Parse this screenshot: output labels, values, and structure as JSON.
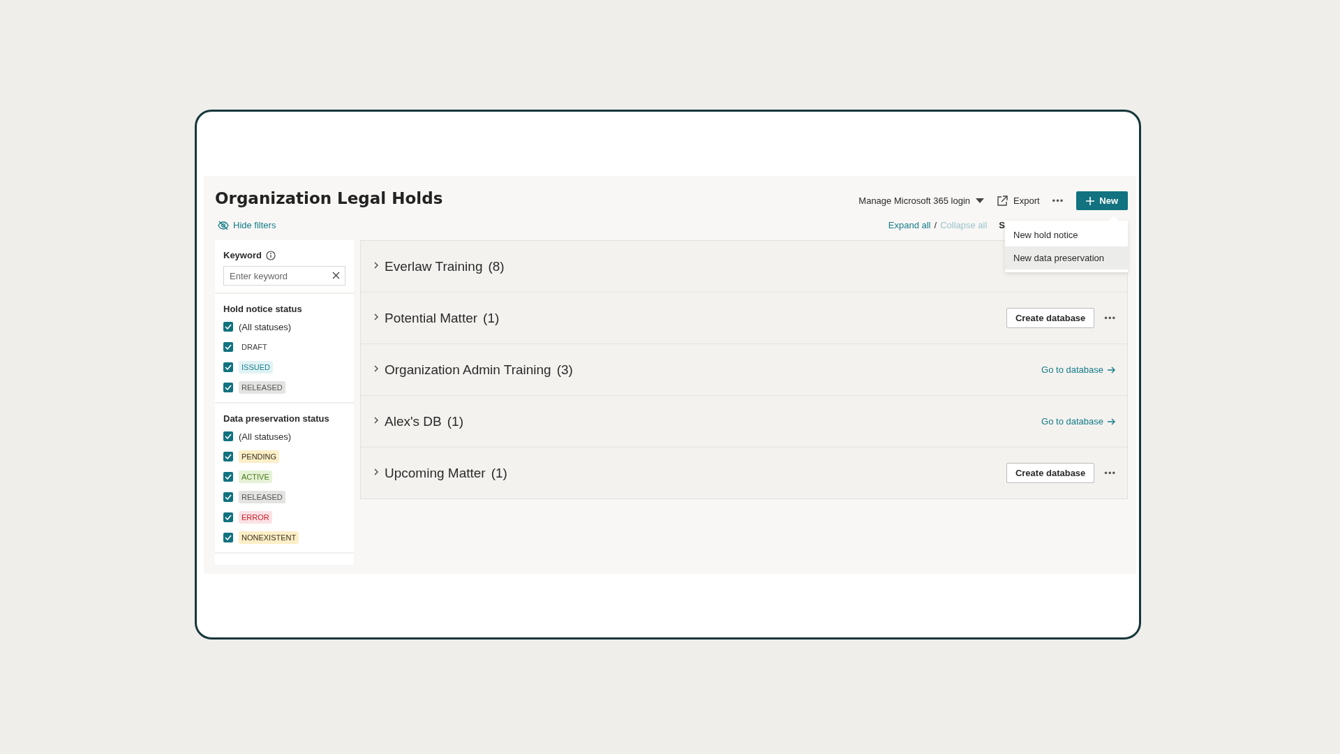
{
  "page": {
    "title": "Organization Legal Holds"
  },
  "toolbar": {
    "login_menu": "Manage Microsoft 365 login",
    "export": "Export",
    "more": "•••",
    "new_button": "New"
  },
  "new_menu": {
    "items": [
      {
        "label": "New hold notice",
        "selected": false
      },
      {
        "label": "New data preservation",
        "selected": true
      }
    ]
  },
  "hide_filters": "Hide filters",
  "expand_collapse": {
    "expand": {
      "label": "Expand all",
      "disabled": false
    },
    "separator": "/",
    "collapse": {
      "label": "Collapse all",
      "disabled": true
    },
    "cut_label": "S"
  },
  "filters": {
    "keyword": {
      "label": "Keyword",
      "placeholder": "Enter keyword"
    },
    "groups": [
      {
        "title": "Hold notice status",
        "options": [
          {
            "label": "(All statuses)",
            "kind": "all",
            "checked": true
          },
          {
            "label": "DRAFT",
            "kind": "plain",
            "checked": true
          },
          {
            "label": "ISSUED",
            "kind": "info",
            "checked": true
          },
          {
            "label": "RELEASED",
            "kind": "neutral",
            "checked": true
          }
        ]
      },
      {
        "title": "Data preservation status",
        "options": [
          {
            "label": "(All statuses)",
            "kind": "all",
            "checked": true
          },
          {
            "label": "PENDING",
            "kind": "warning",
            "checked": true
          },
          {
            "label": "ACTIVE",
            "kind": "success",
            "checked": true
          },
          {
            "label": "RELEASED",
            "kind": "neutral",
            "checked": true
          },
          {
            "label": "ERROR",
            "kind": "error",
            "checked": true
          },
          {
            "label": "NONEXISTENT",
            "kind": "warning",
            "checked": true
          }
        ]
      }
    ]
  },
  "groups": [
    {
      "name": "Everlaw Training",
      "count": "(8)",
      "expanded": false,
      "action": {
        "kind": "hidden"
      }
    },
    {
      "name": "Potential Matter",
      "count": "(1)",
      "expanded": false,
      "action": {
        "kind": "button",
        "label": "Create database",
        "more": "•••"
      }
    },
    {
      "name": "Organization Admin Training",
      "count": "(3)",
      "expanded": false,
      "action": {
        "kind": "link",
        "label": "Go to database"
      }
    },
    {
      "name": "Alex's DB",
      "count": "(1)",
      "expanded": false,
      "action": {
        "kind": "link",
        "label": "Go to database"
      }
    },
    {
      "name": "Upcoming Matter",
      "count": "(1)",
      "expanded": false,
      "action": {
        "kind": "button",
        "label": "Create database",
        "more": "•••"
      }
    }
  ]
}
